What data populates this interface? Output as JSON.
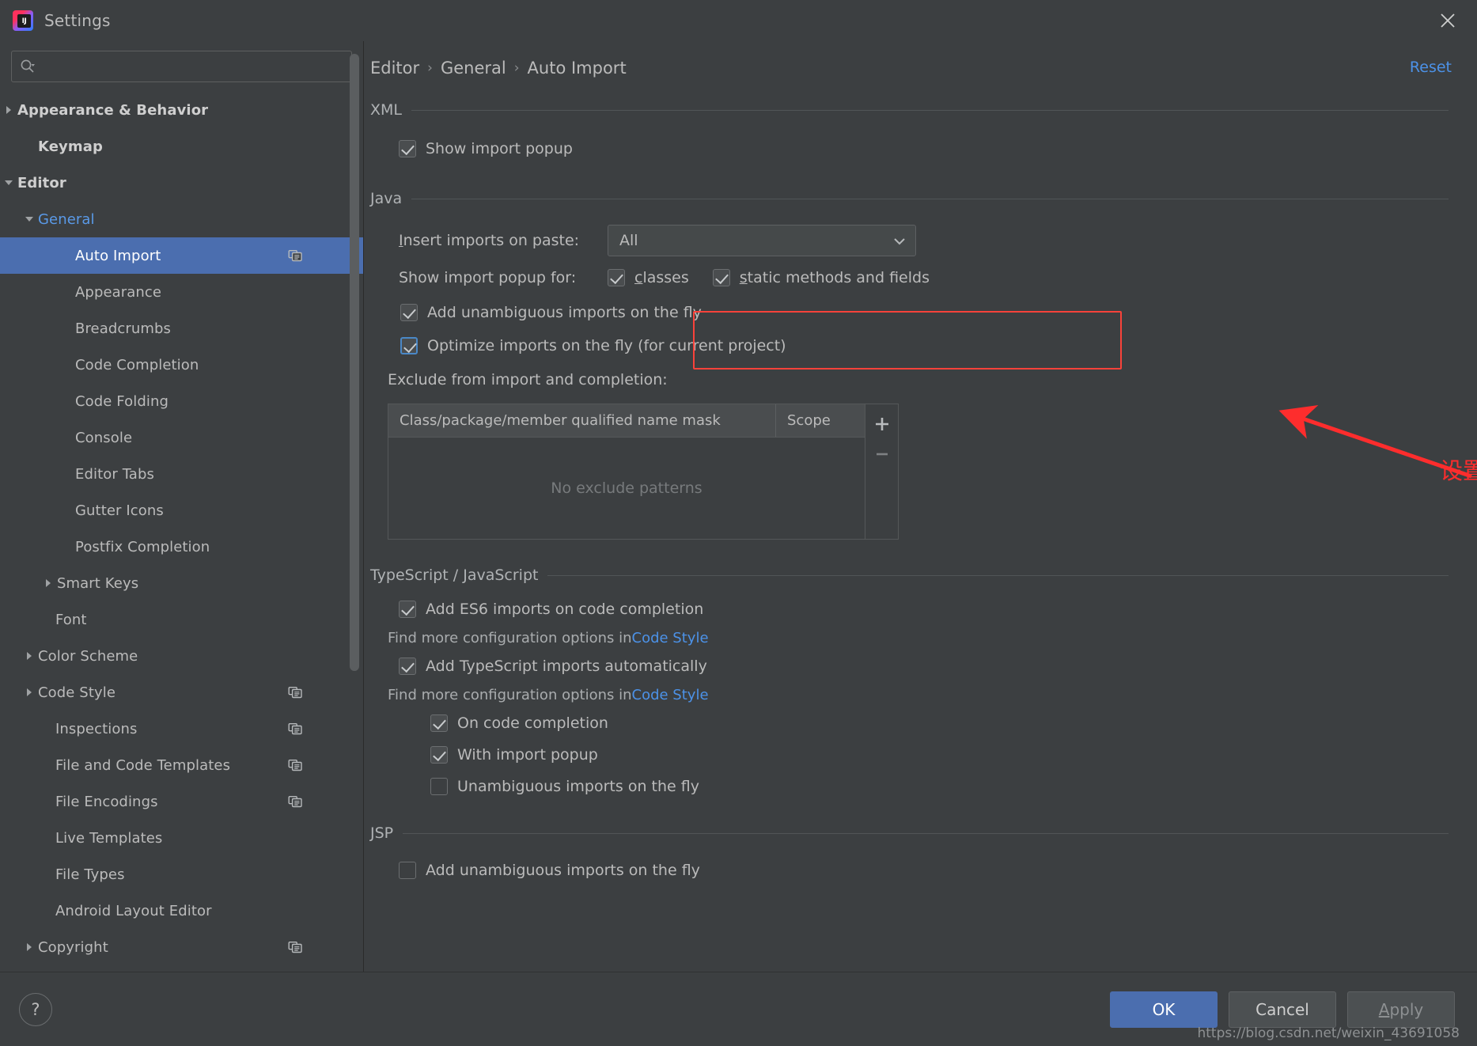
{
  "window": {
    "title": "Settings",
    "logo_text": "IJ",
    "close_icon": "close-icon"
  },
  "search": {
    "value": "",
    "placeholder": ""
  },
  "sidebar": {
    "items": [
      {
        "label": "Appearance & Behavior",
        "arrow": "right",
        "bold": true,
        "indent": 22,
        "selected": false,
        "copy": false
      },
      {
        "label": "Keymap",
        "arrow": "none",
        "bold": true,
        "indent": 48,
        "selected": false,
        "copy": false
      },
      {
        "label": "Editor",
        "arrow": "down",
        "bold": true,
        "indent": 22,
        "selected": false,
        "copy": false
      },
      {
        "label": "General",
        "arrow": "down",
        "bold": false,
        "indent": 48,
        "selected": false,
        "copy": false,
        "blue": true
      },
      {
        "label": "Auto Import",
        "arrow": "none",
        "bold": false,
        "indent": 95,
        "selected": true,
        "copy": true
      },
      {
        "label": "Appearance",
        "arrow": "none",
        "bold": false,
        "indent": 95,
        "selected": false,
        "copy": false
      },
      {
        "label": "Breadcrumbs",
        "arrow": "none",
        "bold": false,
        "indent": 95,
        "selected": false,
        "copy": false
      },
      {
        "label": "Code Completion",
        "arrow": "none",
        "bold": false,
        "indent": 95,
        "selected": false,
        "copy": false
      },
      {
        "label": "Code Folding",
        "arrow": "none",
        "bold": false,
        "indent": 95,
        "selected": false,
        "copy": false
      },
      {
        "label": "Console",
        "arrow": "none",
        "bold": false,
        "indent": 95,
        "selected": false,
        "copy": false
      },
      {
        "label": "Editor Tabs",
        "arrow": "none",
        "bold": false,
        "indent": 95,
        "selected": false,
        "copy": false
      },
      {
        "label": "Gutter Icons",
        "arrow": "none",
        "bold": false,
        "indent": 95,
        "selected": false,
        "copy": false
      },
      {
        "label": "Postfix Completion",
        "arrow": "none",
        "bold": false,
        "indent": 95,
        "selected": false,
        "copy": false
      },
      {
        "label": "Smart Keys",
        "arrow": "right",
        "bold": false,
        "indent": 72,
        "selected": false,
        "copy": false
      },
      {
        "label": "Font",
        "arrow": "none",
        "bold": false,
        "indent": 70,
        "selected": false,
        "copy": false
      },
      {
        "label": "Color Scheme",
        "arrow": "right",
        "bold": false,
        "indent": 48,
        "selected": false,
        "copy": false
      },
      {
        "label": "Code Style",
        "arrow": "right",
        "bold": false,
        "indent": 48,
        "selected": false,
        "copy": true
      },
      {
        "label": "Inspections",
        "arrow": "none",
        "bold": false,
        "indent": 70,
        "selected": false,
        "copy": true
      },
      {
        "label": "File and Code Templates",
        "arrow": "none",
        "bold": false,
        "indent": 70,
        "selected": false,
        "copy": true
      },
      {
        "label": "File Encodings",
        "arrow": "none",
        "bold": false,
        "indent": 70,
        "selected": false,
        "copy": true
      },
      {
        "label": "Live Templates",
        "arrow": "none",
        "bold": false,
        "indent": 70,
        "selected": false,
        "copy": false
      },
      {
        "label": "File Types",
        "arrow": "none",
        "bold": false,
        "indent": 70,
        "selected": false,
        "copy": false
      },
      {
        "label": "Android Layout Editor",
        "arrow": "none",
        "bold": false,
        "indent": 70,
        "selected": false,
        "copy": false
      },
      {
        "label": "Copyright",
        "arrow": "right",
        "bold": false,
        "indent": 48,
        "selected": false,
        "copy": true
      }
    ]
  },
  "header": {
    "breadcrumb": [
      "Editor",
      "General",
      "Auto Import"
    ],
    "separator": "›",
    "reset_label": "Reset"
  },
  "sections": {
    "xml": {
      "title": "XML",
      "show_import_popup": {
        "label": "Show import popup",
        "checked": true
      }
    },
    "java": {
      "title": "Java",
      "insert_imports_label": "Insert imports on paste:",
      "insert_imports_mnemonic": "I",
      "insert_imports_value": "All",
      "show_popup_for_label": "Show import popup for:",
      "classes": {
        "label": "classes",
        "mnemonic": "c",
        "checked": true
      },
      "static_members": {
        "label": "static methods and fields",
        "mnemonic": "s",
        "checked": true
      },
      "add_unambiguous": {
        "label": "Add unambiguous imports on the fly",
        "checked": true
      },
      "optimize_imports": {
        "label": "Optimize imports on the fly (for current project)",
        "checked": true,
        "focused": true
      },
      "exclude_label": "Exclude from import and completion:",
      "table": {
        "columns": [
          "Class/package/member qualified name mask",
          "Scope"
        ],
        "rows": [],
        "empty_message": "No exclude patterns",
        "add_button": "+",
        "remove_button": "−"
      }
    },
    "ts_js": {
      "title": "TypeScript / JavaScript",
      "add_es6": {
        "label": "Add ES6 imports on code completion",
        "checked": true
      },
      "hint1_prefix": "Find more configuration options in ",
      "hint1_link": "Code Style",
      "add_ts": {
        "label": "Add TypeScript imports automatically",
        "checked": true
      },
      "hint2_prefix": "Find more configuration options in ",
      "hint2_link": "Code Style",
      "on_code_completion": {
        "label": "On code completion",
        "checked": true
      },
      "with_import_popup": {
        "label": "With import popup",
        "checked": true
      },
      "unambiguous_on_fly": {
        "label": "Unambiguous imports on the fly",
        "checked": false
      }
    },
    "jsp": {
      "title": "JSP",
      "add_unambiguous": {
        "label": "Add unambiguous imports on the fly",
        "checked": false
      }
    }
  },
  "annotation": {
    "text": "设置后会自动导包",
    "color": "#fd2d2d"
  },
  "footer": {
    "help_label": "?",
    "ok": "OK",
    "cancel": "Cancel",
    "apply": "Apply",
    "apply_mnemonic": "A"
  },
  "watermark": "https://blog.csdn.net/weixin_43691058",
  "colors": {
    "background": "#3c3f41",
    "selection": "#4b6eaf",
    "link": "#4c92e8",
    "annotation": "#fd2d2d",
    "text": "#bbbbbb"
  }
}
